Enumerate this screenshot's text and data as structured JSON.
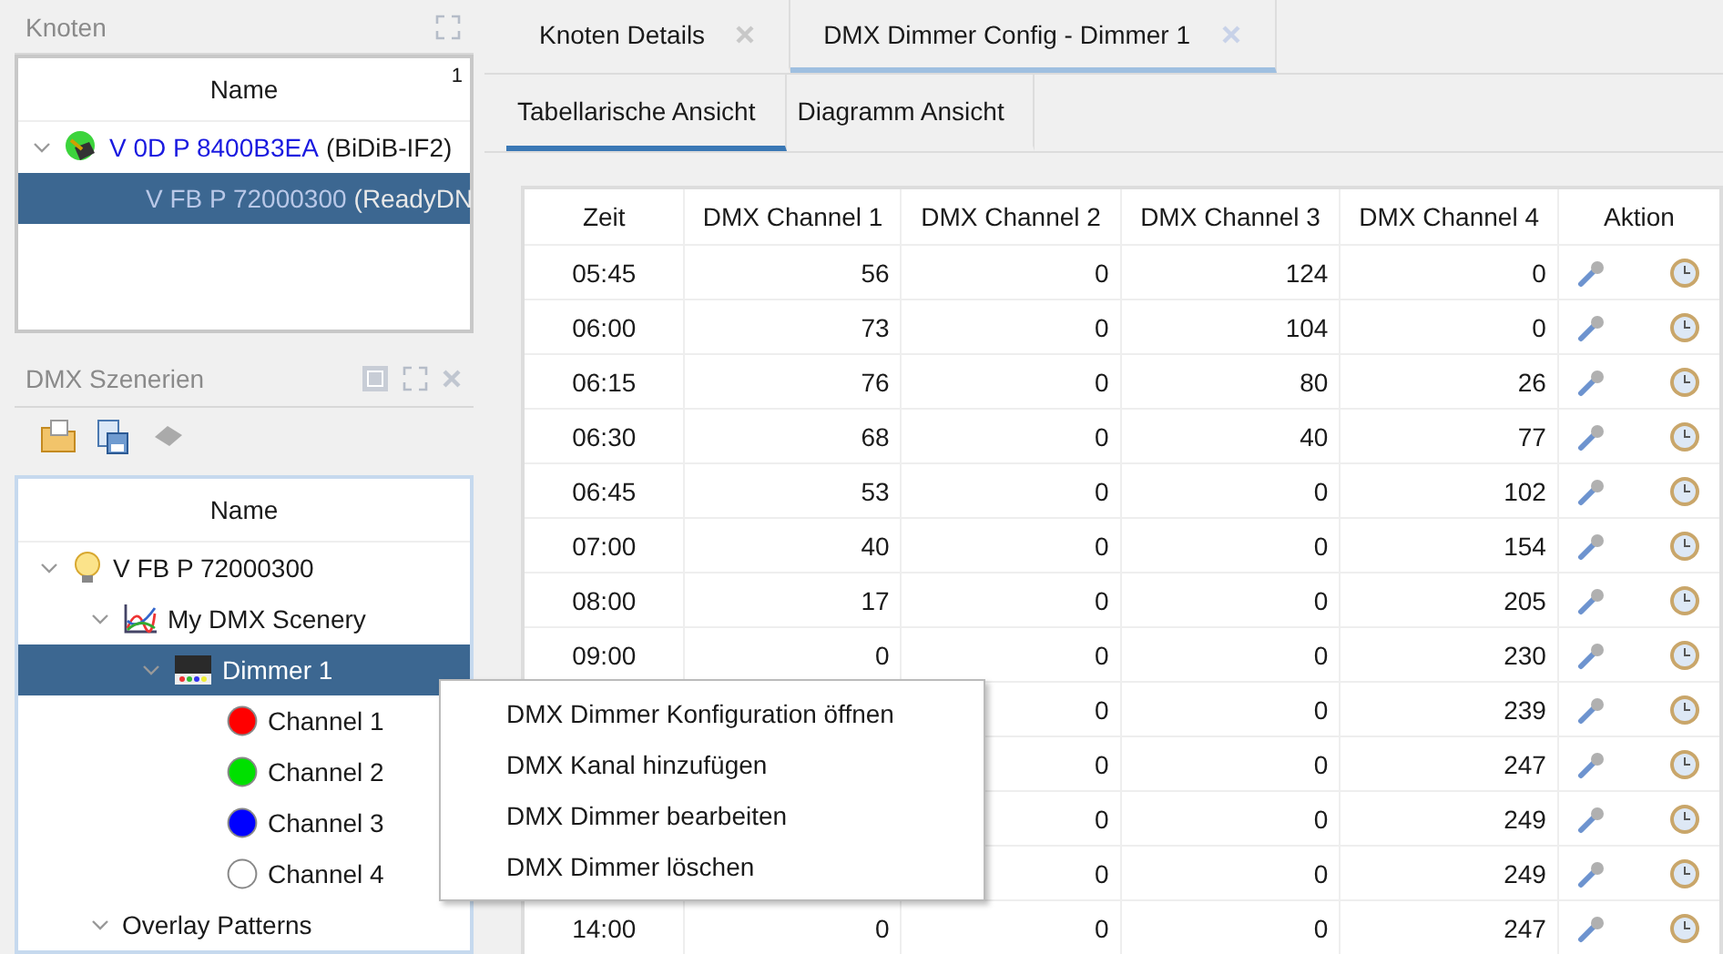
{
  "nodes_panel": {
    "title": "Knoten",
    "column": "Name",
    "sort_index": "1",
    "tree": [
      {
        "id": "V 0D P 8400B3EA",
        "type": "(BiDiB-IF2)",
        "kind": "interface",
        "expanded": true,
        "selected": false,
        "children": [
          {
            "id": "V FB P 72000300",
            "type": "(ReadyDN",
            "kind": "node",
            "selected": true
          }
        ]
      }
    ]
  },
  "scenes_panel": {
    "title": "DMX Szenerien",
    "column": "Name",
    "tree": [
      {
        "label": "V FB P 72000300",
        "kind": "bulb",
        "expanded": true,
        "selected": false,
        "children": [
          {
            "label": "My DMX Scenery",
            "kind": "scenery",
            "expanded": true,
            "selected": false,
            "children": [
              {
                "label": "Dimmer 1",
                "kind": "dimmer",
                "expanded": true,
                "selected": true,
                "children": [
                  {
                    "label": "Channel 1",
                    "kind": "channel",
                    "color": "#ff0000",
                    "selected": false
                  },
                  {
                    "label": "Channel 2",
                    "kind": "channel",
                    "color": "#00e000",
                    "selected": false
                  },
                  {
                    "label": "Channel 3",
                    "kind": "channel",
                    "color": "#0000ff",
                    "selected": false
                  },
                  {
                    "label": "Channel 4",
                    "kind": "channel",
                    "color": "#ffffff",
                    "selected": false
                  }
                ]
              }
            ]
          },
          {
            "label": "Overlay Patterns",
            "kind": "folder",
            "expanded": true,
            "selected": false
          }
        ]
      }
    ]
  },
  "editor_tabs": [
    {
      "label": "Knoten Details",
      "selected": false
    },
    {
      "label": "DMX Dimmer Config - Dimmer 1",
      "selected": true
    }
  ],
  "view_tabs": [
    {
      "label": "Tabellarische Ansicht",
      "selected": true
    },
    {
      "label": "Diagramm Ansicht",
      "selected": false
    }
  ],
  "table": {
    "columns": [
      "Zeit",
      "DMX Channel 1",
      "DMX Channel 2",
      "DMX Channel 3",
      "DMX Channel 4",
      "Aktion"
    ],
    "rows": [
      [
        "05:45",
        "56",
        "0",
        "124",
        "0"
      ],
      [
        "06:00",
        "73",
        "0",
        "104",
        "0"
      ],
      [
        "06:15",
        "76",
        "0",
        "80",
        "26"
      ],
      [
        "06:30",
        "68",
        "0",
        "40",
        "77"
      ],
      [
        "06:45",
        "53",
        "0",
        "0",
        "102"
      ],
      [
        "07:00",
        "40",
        "0",
        "0",
        "154"
      ],
      [
        "08:00",
        "17",
        "0",
        "0",
        "205"
      ],
      [
        "09:00",
        "0",
        "0",
        "0",
        "230"
      ],
      [
        null,
        null,
        "0",
        "0",
        "239"
      ],
      [
        null,
        null,
        "0",
        "0",
        "247"
      ],
      [
        null,
        null,
        "0",
        "0",
        "249"
      ],
      [
        null,
        null,
        "0",
        "0",
        "249"
      ],
      [
        "14:00",
        "0",
        "0",
        "0",
        "247"
      ]
    ]
  },
  "context_menu": [
    "DMX Dimmer Konfiguration öffnen",
    "DMX Kanal hinzufügen",
    "DMX Dimmer bearbeiten",
    "DMX Dimmer löschen"
  ]
}
